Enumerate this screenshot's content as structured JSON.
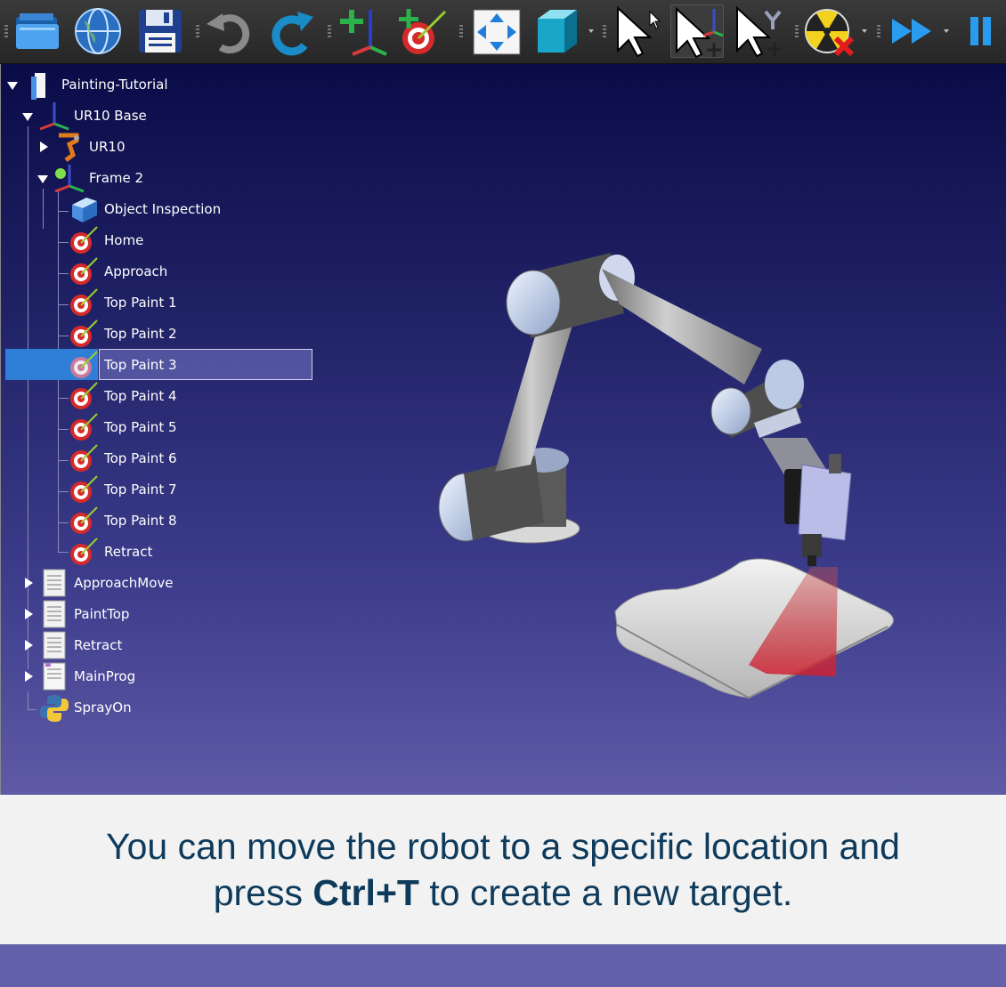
{
  "toolbar": {
    "buttons": [
      {
        "name": "open-folder-icon"
      },
      {
        "name": "globe-icon"
      },
      {
        "name": "save-icon"
      },
      {
        "name": "undo-icon"
      },
      {
        "name": "redo-icon"
      },
      {
        "name": "add-reference-frame-icon"
      },
      {
        "name": "add-target-icon"
      },
      {
        "name": "fit-all-icon"
      },
      {
        "name": "3d-view-icon"
      },
      {
        "name": "select-icon"
      },
      {
        "name": "move-reference-icon"
      },
      {
        "name": "move-tool-icon"
      },
      {
        "name": "collision-check-icon"
      },
      {
        "name": "fast-simulation-icon"
      },
      {
        "name": "pause-icon"
      }
    ]
  },
  "tree": {
    "station": "Painting-Tutorial",
    "base": "UR10 Base",
    "robot": "UR10",
    "frame": "Frame 2",
    "object": "Object Inspection",
    "targets": [
      "Home",
      "Approach",
      "Top Paint 1",
      "Top Paint 2",
      "Top Paint 3",
      "Top Paint 4",
      "Top Paint 5",
      "Top Paint 6",
      "Top Paint 7",
      "Top Paint 8",
      "Retract"
    ],
    "selected_target": "Top Paint 3",
    "programs": [
      "ApproachMove",
      "PaintTop",
      "Retract",
      "MainProg"
    ],
    "script": "SprayOn"
  },
  "caption": {
    "line1": "You can move the robot to a specific location and",
    "line2_pre": "press ",
    "line2_bold": "Ctrl+T",
    "line2_post": " to create a new target."
  }
}
